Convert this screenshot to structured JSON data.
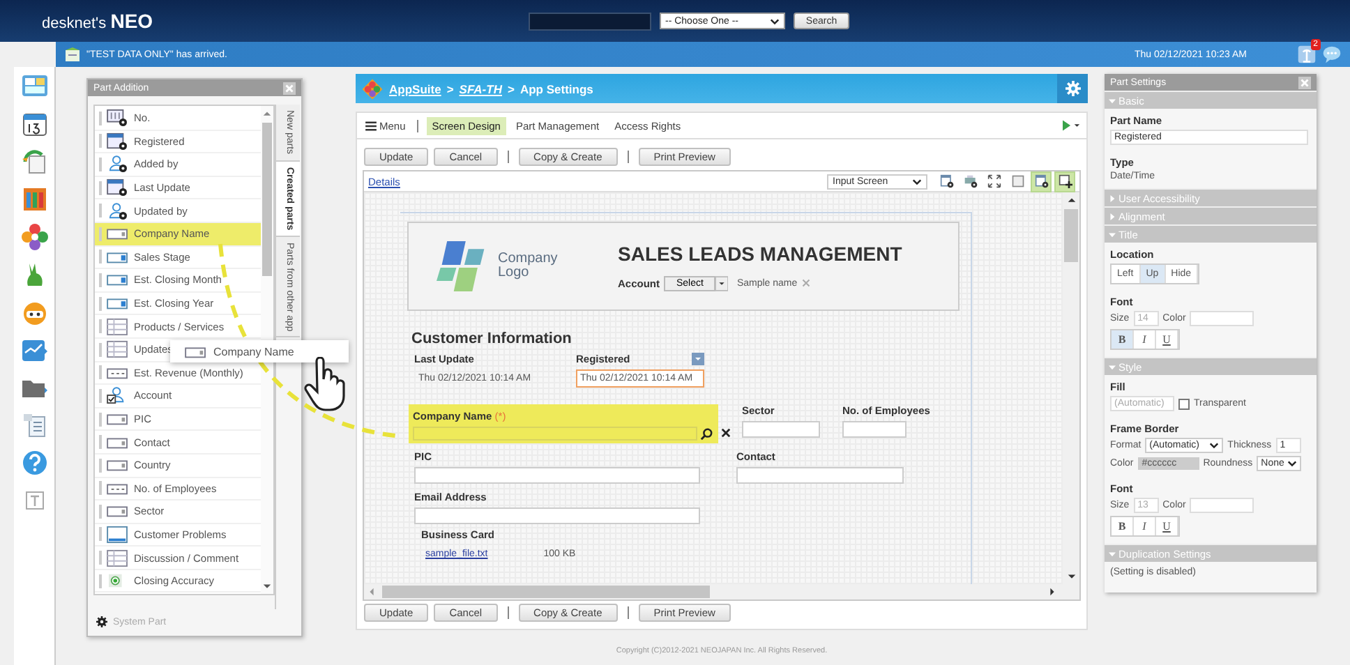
{
  "header": {
    "logo_text": "desknet's",
    "logo_mark": "NEO",
    "search_select": "-- Choose One --",
    "search_button": "Search"
  },
  "notice": {
    "message": "\"TEST DATA ONLY\" has arrived.",
    "datetime": "Thu 02/12/2021 10:23 AM",
    "badge": "2"
  },
  "part_addition": {
    "title": "Part Addition",
    "footer": "System Part",
    "items": [
      {
        "label": "No.",
        "kind": "number",
        "system": true,
        "selected": false
      },
      {
        "label": "Registered",
        "kind": "date",
        "system": true,
        "selected": false
      },
      {
        "label": "Added by",
        "kind": "user",
        "system": true,
        "selected": false
      },
      {
        "label": "Last Update",
        "kind": "date",
        "system": true,
        "selected": false
      },
      {
        "label": "Updated by",
        "kind": "user",
        "system": true,
        "selected": false
      },
      {
        "label": "Company Name",
        "kind": "text",
        "system": false,
        "selected": true
      },
      {
        "label": "Sales Stage",
        "kind": "select",
        "system": false,
        "selected": false
      },
      {
        "label": "Est. Closing Month",
        "kind": "select",
        "system": false,
        "selected": false
      },
      {
        "label": "Est. Closing Year",
        "kind": "select",
        "system": false,
        "selected": false
      },
      {
        "label": "Products / Services",
        "kind": "table",
        "system": false,
        "selected": false
      },
      {
        "label": "Updates",
        "kind": "table",
        "system": false,
        "selected": false
      },
      {
        "label": "Est. Revenue (Monthly)",
        "kind": "numeric",
        "system": false,
        "selected": false
      },
      {
        "label": "Account",
        "kind": "usercheck",
        "system": false,
        "selected": false
      },
      {
        "label": "PIC",
        "kind": "text",
        "system": false,
        "selected": false
      },
      {
        "label": "Contact",
        "kind": "text",
        "system": false,
        "selected": false
      },
      {
        "label": "Country",
        "kind": "text",
        "system": false,
        "selected": false
      },
      {
        "label": "No. of Employees",
        "kind": "numeric",
        "system": false,
        "selected": false
      },
      {
        "label": "Sector",
        "kind": "text",
        "system": false,
        "selected": false
      },
      {
        "label": "Customer Problems",
        "kind": "multiline",
        "system": false,
        "selected": false
      },
      {
        "label": "Discussion / Comment",
        "kind": "table",
        "system": false,
        "selected": false
      },
      {
        "label": "Closing Accuracy",
        "kind": "radio",
        "system": false,
        "selected": false
      }
    ],
    "tabs": [
      {
        "label": "New parts",
        "selected": false
      },
      {
        "label": "Created parts",
        "selected": true
      },
      {
        "label": "Parts from other app",
        "selected": false
      }
    ]
  },
  "drag_ghost": {
    "label": "Company Name"
  },
  "app": {
    "separator": ">",
    "breadcrumb": [
      {
        "label": "AppSuite",
        "kind": "link"
      },
      {
        "label": "SFA-TH",
        "kind": "current"
      },
      {
        "label": "App Settings",
        "kind": "plain"
      }
    ],
    "menu": "Menu",
    "tabs": [
      {
        "label": "Screen Design",
        "selected": true
      },
      {
        "label": "Part Management",
        "selected": false
      },
      {
        "label": "Access Rights",
        "selected": false
      }
    ],
    "top_buttons": [
      "Update",
      "Cancel",
      "Copy & Create",
      "Print Preview"
    ],
    "details": "Details",
    "view": "Input Screen",
    "toolbar": [
      {
        "kind": "form-gear",
        "on": false
      },
      {
        "kind": "print-gear",
        "on": false
      },
      {
        "kind": "expand",
        "on": false
      },
      {
        "kind": "square",
        "on": false
      },
      {
        "kind": "form-gear",
        "on": true
      },
      {
        "kind": "add",
        "on": true
      }
    ],
    "form": {
      "logo_text": "Company Logo",
      "title": "SALES LEADS MANAGEMENT",
      "account_label": "Account",
      "account_button": "Select",
      "account_value": "Sample name",
      "section": "Customer Information",
      "last_update_label": "Last Update",
      "last_update_value": "Thu 02/12/2021 10:14 AM",
      "registered_label": "Registered",
      "registered_value": "Thu 02/12/2021 10:14 AM",
      "registered_selected": true,
      "company_label": "Company Name",
      "company_required": "(*)",
      "company_highlighted": true,
      "sector_label": "Sector",
      "employees_label": "No. of Employees",
      "pic_label": "PIC",
      "contact_label": "Contact",
      "email_label": "Email Address",
      "card_label": "Business Card",
      "card_file": "sample_file.txt",
      "card_size": "100 KB"
    },
    "bottom_buttons": [
      "Update",
      "Cancel",
      "Copy & Create",
      "Print Preview"
    ]
  },
  "copyright": "Copyright (C)2012-2021 NEOJAPAN Inc. All Rights Reserved.",
  "part_settings": {
    "title": "Part Settings",
    "sections": [
      {
        "kind": "basic",
        "title": "Basic",
        "expanded": true,
        "name_label": "Part Name",
        "name_value": "Registered",
        "type_label": "Type",
        "type_value": "Date/Time"
      },
      {
        "title": "User Accessibility",
        "expanded": false
      },
      {
        "title": "Alignment",
        "expanded": false
      },
      {
        "kind": "title",
        "title": "Title",
        "expanded": true,
        "location_label": "Location",
        "locations": [
          {
            "label": "Left",
            "selected": false
          },
          {
            "label": "Up",
            "selected": true
          },
          {
            "label": "Hide",
            "selected": false
          }
        ],
        "font": {
          "label": "Font",
          "size_label": "Size",
          "size": "14",
          "color_label": "Color",
          "styles": [
            {
              "label": "B",
              "kind": "bold",
              "selected": true
            },
            {
              "label": "I",
              "kind": "italic",
              "selected": false
            },
            {
              "label": "U",
              "kind": "underline",
              "selected": false
            }
          ]
        }
      },
      {
        "kind": "style",
        "title": "Style",
        "expanded": true,
        "fill_label": "Fill",
        "fill_value": "(Automatic)",
        "transparent_label": "Transparent",
        "transparent": false,
        "border_label": "Frame Border",
        "format_label": "Format",
        "format": "(Automatic)",
        "thickness_label": "Thickness",
        "thickness": "1",
        "color_label": "Color",
        "color": "#cccccc",
        "roundness_label": "Roundness",
        "roundness": "None",
        "font": {
          "label": "Font",
          "size_label": "Size",
          "size": "13",
          "color_label": "Color",
          "styles": [
            {
              "label": "B",
              "kind": "bold",
              "selected": false
            },
            {
              "label": "I",
              "kind": "italic",
              "selected": false
            },
            {
              "label": "U",
              "kind": "underline",
              "selected": false
            }
          ]
        }
      },
      {
        "kind": "duplication",
        "title": "Duplication Settings",
        "expanded": true,
        "text": "(Setting is disabled)"
      }
    ]
  }
}
